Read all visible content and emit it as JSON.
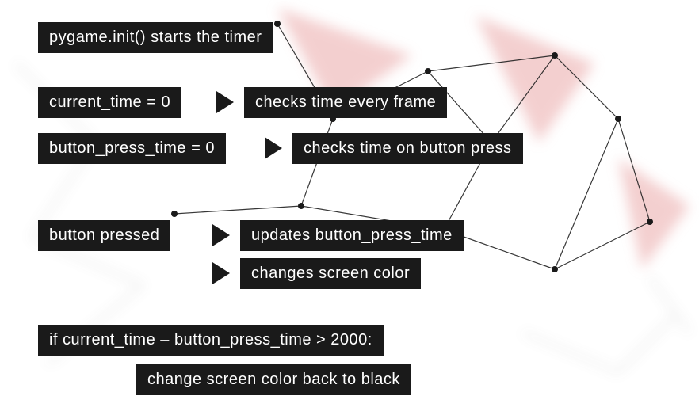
{
  "boxes": {
    "init": "pygame.init() starts the timer",
    "current_time": "current_time = 0",
    "current_time_desc": "checks time every frame",
    "button_press_time": "button_press_time = 0",
    "button_press_time_desc": "checks time on button press",
    "button_pressed": "button pressed",
    "updates": "updates button_press_time",
    "changes_color": "changes screen color",
    "condition": "if current_time – button_press_time > 2000:",
    "result": "change screen color back to black"
  }
}
